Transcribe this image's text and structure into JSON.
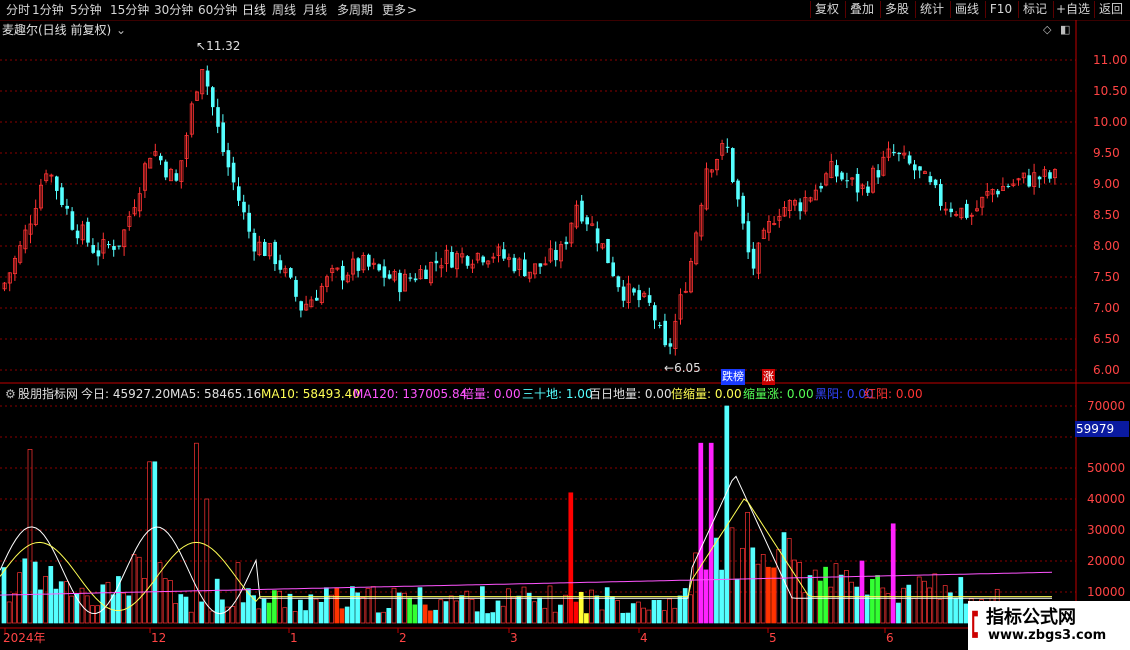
{
  "toolbar": {
    "periods": [
      "分时",
      "1分钟",
      "5分钟",
      "15分钟",
      "30分钟",
      "60分钟",
      "日线",
      "周线",
      "月线",
      "多周期",
      "更多"
    ],
    "active_period": "日线",
    "more_arrow": ">",
    "right_buttons": [
      "复权",
      "叠加",
      "多股",
      "统计",
      "画线",
      "F10",
      "标记",
      "+自选",
      "返回"
    ]
  },
  "main_chart": {
    "title": "麦趣尔(日线 前复权)",
    "high_label": "11.32",
    "low_label": "6.05",
    "price_axis": [
      "11.00",
      "10.50",
      "10.00",
      "9.50",
      "9.00",
      "8.50",
      "8.00",
      "7.50",
      "7.00",
      "6.50",
      "6.00"
    ],
    "tags": [
      "跌榜",
      "涨"
    ]
  },
  "indicator": {
    "name": "股朋指标网",
    "items": [
      {
        "label": "今日:",
        "value": "45927.20",
        "color": "#e0e0e0"
      },
      {
        "label": "MA5:",
        "value": "58465.16",
        "color": "#e0e0e0"
      },
      {
        "label": "MA10:",
        "value": "58493.40",
        "color": "#ffff55"
      },
      {
        "label": "MA120:",
        "value": "137005.84",
        "color": "#ff55ff"
      },
      {
        "label": "倍量:",
        "value": "0.00",
        "color": "#ff55ff"
      },
      {
        "label": "三十地:",
        "value": "1.00",
        "color": "#55ffff"
      },
      {
        "label": "百日地量:",
        "value": "0.00",
        "color": "#e0e0e0"
      },
      {
        "label": "倍缩量:",
        "value": "0.00",
        "color": "#ffff55"
      },
      {
        "label": "缩量涨:",
        "value": "0.00",
        "color": "#55ff55"
      },
      {
        "label": "黑阳:",
        "value": "0.00",
        "color": "#3344ff"
      },
      {
        "label": "红阳:",
        "value": "0.00",
        "color": "#ff3333"
      }
    ],
    "vol_axis": [
      "70000",
      "60000",
      "50000",
      "40000",
      "30000",
      "20000",
      "10000"
    ],
    "current_marker": "59979"
  },
  "date_axis": [
    "2024年",
    "12",
    "1",
    "2",
    "3",
    "4",
    "5",
    "6"
  ],
  "watermark": {
    "title": "指标公式网",
    "url": "www.zbgs3.com"
  },
  "colors": {
    "up": "#ff3333",
    "down": "#55ffff",
    "grid": "#7a0000",
    "axis": "#ff3333"
  }
}
